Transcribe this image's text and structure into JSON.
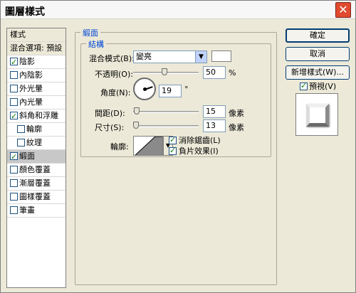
{
  "window": {
    "title": "圖層樣式",
    "close_glyph": "✕"
  },
  "left_list": {
    "items": [
      {
        "label": "樣式",
        "kind": "header"
      },
      {
        "label": "混合選項: 預設",
        "kind": "header"
      },
      {
        "label": "陰影",
        "kind": "check",
        "checked": true
      },
      {
        "label": "內陰影",
        "kind": "check",
        "checked": false
      },
      {
        "label": "外光暈",
        "kind": "check",
        "checked": false
      },
      {
        "label": "內光暈",
        "kind": "check",
        "checked": false
      },
      {
        "label": "斜角和浮雕",
        "kind": "check",
        "checked": true
      },
      {
        "label": "輪廓",
        "kind": "subcheck",
        "checked": false
      },
      {
        "label": "紋理",
        "kind": "subcheck",
        "checked": false
      },
      {
        "label": "緞面",
        "kind": "check",
        "checked": true,
        "selected": true
      },
      {
        "label": "顏色覆蓋",
        "kind": "check",
        "checked": false
      },
      {
        "label": "漸層覆蓋",
        "kind": "check",
        "checked": false
      },
      {
        "label": "圖樣覆蓋",
        "kind": "check",
        "checked": false
      },
      {
        "label": "筆畫",
        "kind": "check",
        "checked": false
      }
    ]
  },
  "satin": {
    "group_title": "緞面",
    "structure_title": "結構",
    "blend_mode_label": "混合模式(B):",
    "blend_mode_value": "變亮",
    "opacity_label": "不透明(O):",
    "opacity_value": "50",
    "opacity_unit": "%",
    "opacity_fraction": 0.5,
    "angle_label": "角度(N):",
    "angle_value": "19",
    "angle_unit": "°",
    "distance_label": "間距(D):",
    "distance_value": "15",
    "distance_unit": "像素",
    "distance_fraction": 0.06,
    "size_label": "尺寸(S):",
    "size_value": "13",
    "size_unit": "像素",
    "size_fraction": 0.05,
    "contour_label": "輪廓:",
    "anti_alias_label": "消除鋸齒(L)",
    "anti_alias_checked": true,
    "invert_label": "負片效果(I)",
    "invert_checked": true
  },
  "buttons": {
    "ok": "確定",
    "cancel": "取消",
    "new_style": "新增樣式(W)...",
    "preview_label": "預視(V)",
    "preview_checked": true
  }
}
